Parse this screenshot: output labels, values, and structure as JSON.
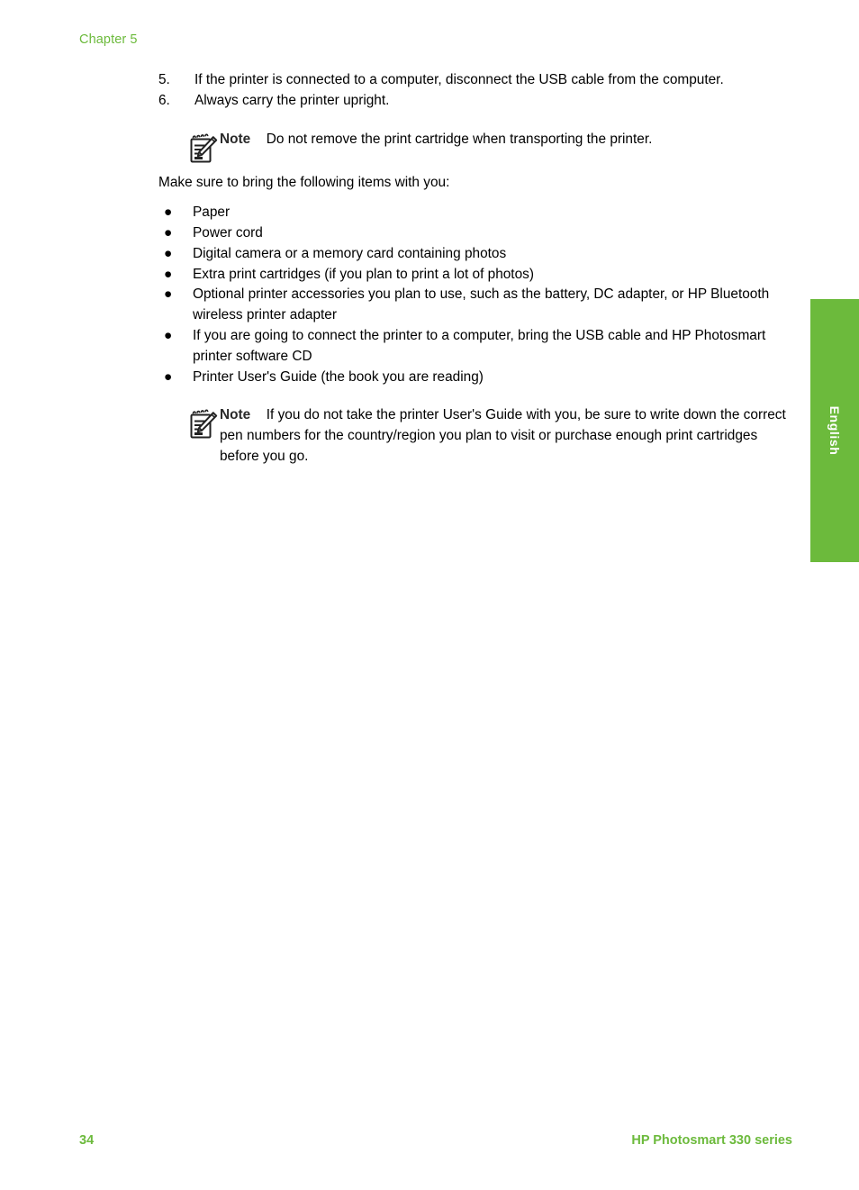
{
  "header": {
    "chapter_label": "Chapter 5"
  },
  "numbered_steps": [
    {
      "number": "5.",
      "text": "If the printer is connected to a computer, disconnect the USB cable from the computer."
    },
    {
      "number": "6.",
      "text": "Always carry the printer upright."
    }
  ],
  "note_1": {
    "label": "Note",
    "text": "Do not remove the print cartridge when transporting the printer.",
    "icon": "note-pad-pencil-icon"
  },
  "intro_paragraph": "Make sure to bring the following items with you:",
  "bullets": [
    {
      "text": "Paper"
    },
    {
      "text": "Power cord"
    },
    {
      "text": "Digital camera or a memory card containing photos"
    },
    {
      "text": "Extra print cartridges (if you plan to print a lot of photos)"
    },
    {
      "text": "Optional printer accessories you plan to use, such as the battery, DC adapter, or HP Bluetooth wireless printer adapter"
    },
    {
      "text": "If you are going to connect the printer to a computer, bring the USB cable and HP Photosmart printer software CD"
    },
    {
      "text": "Printer User's Guide (the book you are reading)"
    }
  ],
  "note_2": {
    "label": "Note",
    "text": "If you do not take the printer User's Guide with you, be sure to write down the correct pen numbers for the country/region you plan to visit or purchase enough print cartridges before you go.",
    "icon": "note-pad-pencil-icon"
  },
  "language_tab": {
    "label": "English",
    "color": "#6cba3c"
  },
  "footer": {
    "page_number": "34",
    "product_name": "HP Photosmart 330 series",
    "color": "#6cba3c"
  },
  "bullet_glyph": "●"
}
